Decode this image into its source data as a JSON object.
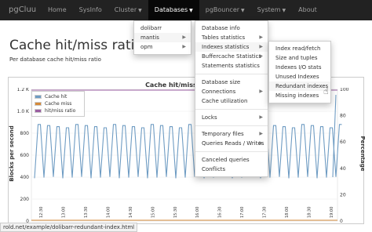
{
  "navbar": {
    "brand": "pgCluu",
    "items": [
      {
        "label": "Home"
      },
      {
        "label": "SysInfo"
      },
      {
        "label": "Cluster"
      },
      {
        "label": "Databases"
      },
      {
        "label": "pgBouncer"
      },
      {
        "label": "System"
      },
      {
        "label": "About"
      }
    ]
  },
  "page": {
    "title": "Cache hit/miss ratio on",
    "subtitle": "Per database cache hit/miss ratio"
  },
  "databases_menu": [
    "dolibarr",
    "mantis",
    "opm"
  ],
  "db_submenu": {
    "items": [
      {
        "label": "Database info",
        "has_sub": false
      },
      {
        "label": "Tables statistics",
        "has_sub": true
      },
      {
        "label": "Indexes statistics",
        "has_sub": true
      },
      {
        "label": "Buffercache Statistics",
        "has_sub": true
      },
      {
        "label": "Statements statistics",
        "has_sub": false
      },
      {
        "label": "divider"
      },
      {
        "label": "Database size",
        "has_sub": false
      },
      {
        "label": "Connections",
        "has_sub": true
      },
      {
        "label": "Cache utilization",
        "has_sub": false
      },
      {
        "label": "divider"
      },
      {
        "label": "Locks",
        "has_sub": true
      },
      {
        "label": "divider"
      },
      {
        "label": "Temporary files",
        "has_sub": true
      },
      {
        "label": "Queries Reads / Writes",
        "has_sub": true
      },
      {
        "label": "divider"
      },
      {
        "label": "Canceled queries",
        "has_sub": false
      },
      {
        "label": "Conflicts",
        "has_sub": false
      }
    ]
  },
  "index_submenu": [
    "Index read/fetch",
    "Size and tuples",
    "Indexes I/O stats",
    "Unused Indexes",
    "Redundant indexes",
    "Missing indexes"
  ],
  "status_bar": "rold.net/example/dolibarr-redundant-index.html",
  "colors": {
    "navbar": "#222222",
    "hit": "#6f9cc3",
    "miss": "#d58a3a",
    "ratio": "#9a5ea1"
  },
  "chart_data": {
    "type": "line",
    "title": "Cache hit/miss ratio on",
    "ylabel_left": "Blocks per second",
    "ylabel_right": "Percentage",
    "y_ticks_left": [
      "1.2 K",
      "1.0 K",
      "800",
      "600",
      "400",
      "200",
      "0"
    ],
    "y_ticks_right": [
      "100",
      "80",
      "60",
      "40",
      "20",
      "0"
    ],
    "x_ticks": [
      "12:30",
      "13:00",
      "13:30",
      "14:00",
      "14:30",
      "15:00",
      "15:30",
      "16:00",
      "16:30",
      "17:00",
      "17:30",
      "18:00",
      "18:30",
      "19:00"
    ],
    "ylim_left": [
      0,
      1200
    ],
    "ylim_right": [
      0,
      100
    ],
    "legend_position": "top-left",
    "series": [
      {
        "name": "Cache hit",
        "baseline": 390,
        "peak": 880
      },
      {
        "name": "Cache miss",
        "value": 0
      },
      {
        "name": "hit/miss ratio",
        "value": 100
      }
    ]
  }
}
